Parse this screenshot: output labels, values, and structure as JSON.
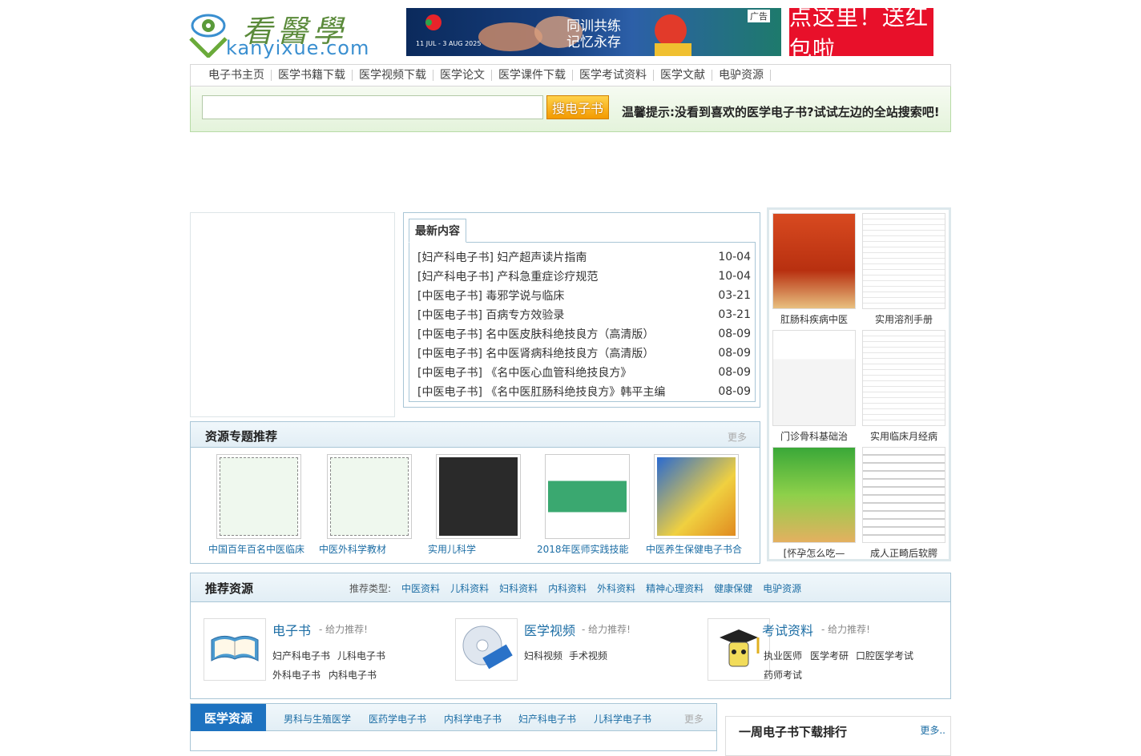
{
  "header": {
    "logo_cn": "看醫學",
    "logo_en": "kanyixue.com",
    "banner_ad": {
      "ad_tag": "广告",
      "line1": "同训共练",
      "line2": "记忆永存",
      "dates": "11 JUL - 3 AUG 2025"
    },
    "promo": "点这里！送红包啦"
  },
  "nav": [
    "电子书主页",
    "医学书籍下载",
    "医学视频下载",
    "医学论文",
    "医学课件下载",
    "医学考试资料",
    "医学文献",
    "电驴资源"
  ],
  "search": {
    "placeholder": "",
    "button": "搜电子书",
    "tip": "温馨提示:没看到喜欢的医学电子书?试试左边的全站搜索吧!"
  },
  "latest": {
    "tab": "最新内容",
    "items": [
      {
        "title": "[妇产科电子书] 妇产超声读片指南",
        "date": "10-04"
      },
      {
        "title": "[妇产科电子书] 产科急重症诊疗规范",
        "date": "10-04"
      },
      {
        "title": "[中医电子书] 毒邪学说与临床",
        "date": "03-21"
      },
      {
        "title": "[中医电子书] 百病专方效验录",
        "date": "03-21"
      },
      {
        "title": "[中医电子书] 名中医皮肤科绝技良方（高清版）",
        "date": "08-09"
      },
      {
        "title": "[中医电子书] 名中医肾病科绝技良方（高清版）",
        "date": "08-09"
      },
      {
        "title": "[中医电子书] 《名中医心血管科绝技良方》",
        "date": "08-09"
      },
      {
        "title": "[中医电子书] 《名中医肛肠科绝技良方》韩平主编",
        "date": "08-09"
      }
    ]
  },
  "thumbs": [
    {
      "caption": "肛肠科疾病中医"
    },
    {
      "caption": "实用溶剂手册"
    },
    {
      "caption": "门诊骨科基础治"
    },
    {
      "caption": "实用临床月经病"
    },
    {
      "caption": "[怀孕怎么吃—"
    },
    {
      "caption": "成人正畸后软腭"
    }
  ],
  "topics": {
    "title": "资源专题推荐",
    "more": "更多",
    "items": [
      {
        "caption": "中国百年百名中医临床"
      },
      {
        "caption": "中医外科学教材"
      },
      {
        "caption": "实用儿科学"
      },
      {
        "caption": "2018年医师实践技能"
      },
      {
        "caption": "中医养生保健电子书合"
      }
    ]
  },
  "recommend": {
    "title": "推荐资源",
    "types_label": "推荐类型:",
    "types": [
      "中医资料",
      "儿科资料",
      "妇科资料",
      "内科资料",
      "外科资料",
      "精神心理资料",
      "健康保健",
      "电驴资源"
    ],
    "cards": [
      {
        "title": "电子书",
        "slogan": "- 给力推荐!",
        "links": [
          "妇产科电子书",
          "儿科电子书",
          "外科电子书",
          "内科电子书"
        ]
      },
      {
        "title": "医学视频",
        "slogan": "- 给力推荐!",
        "links": [
          "妇科视频",
          "手术视频"
        ]
      },
      {
        "title": "考试资料",
        "slogan": "- 给力推荐!",
        "links": [
          "执业医师",
          "医学考研",
          "口腔医学考试",
          "药师考试"
        ]
      }
    ]
  },
  "medres": {
    "tab": "医学资源",
    "cats": [
      "男科与生殖医学",
      "医药学电子书",
      "内科学电子书",
      "妇产科电子书",
      "儿科学电子书"
    ],
    "more": "更多"
  },
  "weekrank": {
    "title": "一周电子书下载排行",
    "more": "更多.."
  }
}
